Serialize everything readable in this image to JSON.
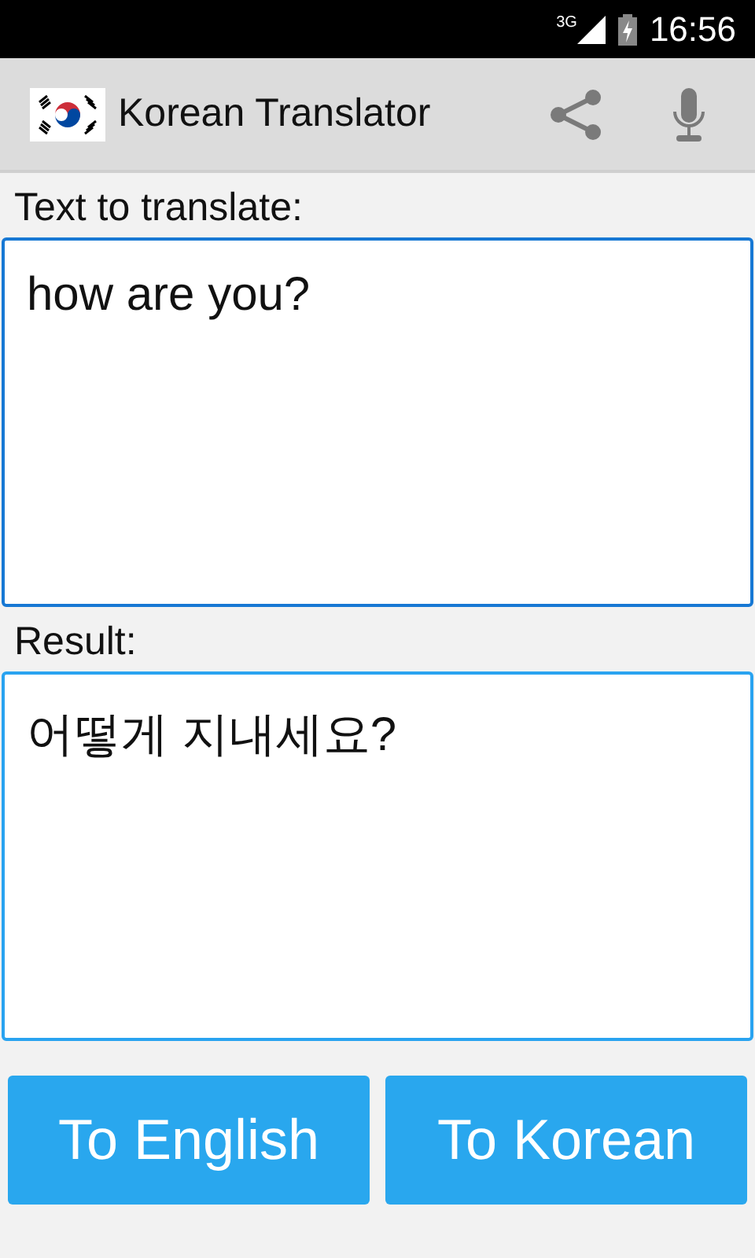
{
  "status_bar": {
    "network": "3G",
    "time": "16:56"
  },
  "app_bar": {
    "title": "Korean Translator"
  },
  "source": {
    "label": "Text to translate:",
    "value": "how are you?",
    "focused": true
  },
  "result": {
    "label": "Result:",
    "value": "어떻게 지내세요?",
    "focused": false
  },
  "buttons": [
    {
      "label": "To English"
    },
    {
      "label": "To Korean"
    }
  ]
}
